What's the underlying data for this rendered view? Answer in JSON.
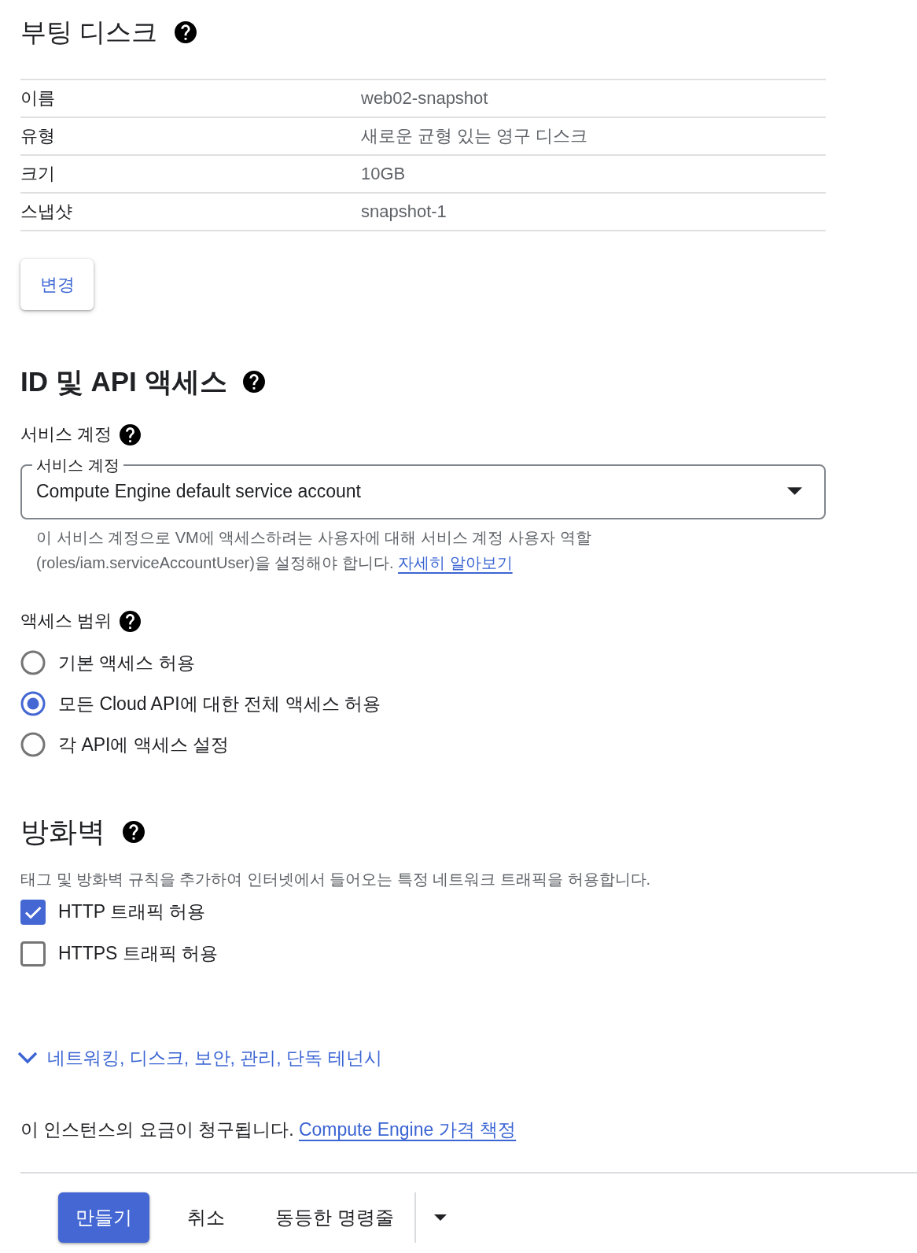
{
  "boot_disk": {
    "title": "부팅 디스크",
    "rows": [
      {
        "label": "이름",
        "value": "web02-snapshot"
      },
      {
        "label": "유형",
        "value": "새로운 균형 있는 영구 디스크"
      },
      {
        "label": "크기",
        "value": "10GB"
      },
      {
        "label": "스냅샷",
        "value": "snapshot-1"
      }
    ],
    "change_button": "변경"
  },
  "identity_api_access": {
    "title": "ID 및 API 액세스",
    "service_account": {
      "label": "서비스 계정",
      "field_label": "서비스 계정",
      "value": "Compute Engine default service account",
      "helper": "이 서비스 계정으로 VM에 액세스하려는 사용자에 대해 서비스 계정 사용자 역할\n(roles/iam.serviceAccountUser)을 설정해야 합니다.",
      "helper_link": "자세히 알아보기"
    },
    "access_scopes": {
      "label": "액세스 범위",
      "options": [
        {
          "label": "기본 액세스 허용",
          "selected": false
        },
        {
          "label": "모든 Cloud API에 대한 전체 액세스 허용",
          "selected": true
        },
        {
          "label": "각 API에 액세스 설정",
          "selected": false
        }
      ]
    }
  },
  "firewall": {
    "title": "방화벽",
    "description": "태그 및 방화벽 규칙을 추가하여 인터넷에서 들어오는 특정 네트워크 트래픽을 허용합니다.",
    "options": [
      {
        "label": "HTTP 트래픽 허용",
        "checked": true
      },
      {
        "label": "HTTPS 트래픽 허용",
        "checked": false
      }
    ]
  },
  "advanced_toggle": {
    "label": "네트워킹, 디스크, 보안, 관리, 단독 테넌시",
    "expanded": false
  },
  "billing_note": {
    "text": "이 인스턴스의 요금이 청구됩니다.",
    "link": "Compute Engine 가격 책정"
  },
  "actions": {
    "create": "만들기",
    "cancel": "취소",
    "equivalent_command": "동등한 명령줄"
  }
}
